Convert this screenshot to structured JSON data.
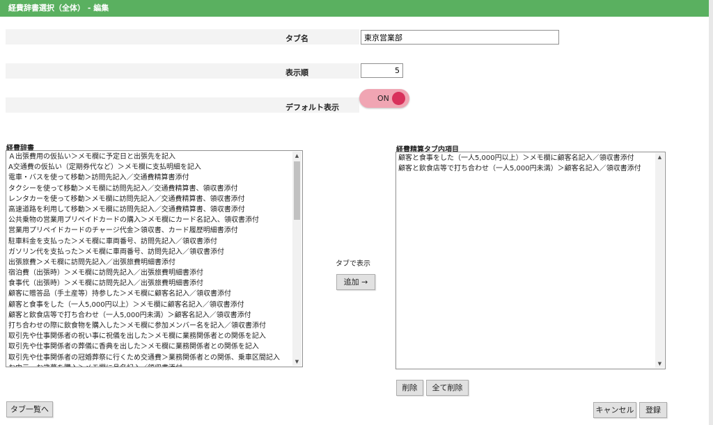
{
  "window": {
    "title": "経費辞書選択（全体） - 編集"
  },
  "form": {
    "tab_name_label": "タブ名",
    "tab_name_value": "東京営業部",
    "display_order_label": "表示順",
    "display_order_value": "5",
    "default_display_label": "デフォルト表示",
    "toggle_label": "ON"
  },
  "expense_dictionary": {
    "label": "経費辞書",
    "items": [
      "Ａ出張費用の仮払い＞メモ欄に予定日と出張先を記入",
      "A交通費の仮払い（定期券代など）＞メモ欄に支払明細を記入",
      "電車・バスを使って移動＞訪問先記入／交通費精算書添付",
      "タクシーを使って移動＞メモ欄に訪問先記入／交通費精算書、領収書添付",
      "レンタカーを使って移動＞メモ欄に訪問先記入／交通費精算書、領収書添付",
      "高速道路を利用して移動＞メモ欄に訪問先記入／交通費精算書、領収書添付",
      "公共乗物の営業用プリペイドカードの購入＞メモ欄にカード名記入、領収書添付",
      "営業用プリペイドカードのチャージ代金＞領収書、カード履歴明細書添付",
      "駐車料金を支払った＞メモ欄に車両番号、訪問先記入／領収書添付",
      "ガソリン代を支払った＞メモ欄に車両番号、訪問先記入／領収書添付",
      "出張旅費＞メモ欄に訪問先記入／出張旅費明細書添付",
      "宿泊費（出張時）＞メモ欄に訪問先記入／出張旅費明細書添付",
      "食事代（出張時）＞メモ欄に訪問先記入／出張旅費明細書添付",
      "顧客に贈答品（手土産等）持参した＞メモ欄に顧客名記入／領収書添付",
      "顧客と食事をした（一人5,000円以上）＞メモ欄に顧客名記入／領収書添付",
      "顧客と飲食店等で打ち合わせ（一人5,000円未満）＞顧客名記入／領収書添付",
      "打ち合わせの際に飲食物を購入した＞メモ欄に参加メンバー名を記入／領収書添付",
      "取引先や仕事関係者の祝い事に祝儀を出した＞メモ欄に業務関係者との関係を記入",
      "取引先や仕事関係者の葬儀に香典を出した＞メモ欄に業務関係者との関係を記入",
      "取引先や仕事関係者の冠婚葬祭に行くため交通費＞業務関係者との関係、乗車区間記入",
      "お中元、お歳暮を購入＞メモ欄に品名記入／領収書添付"
    ]
  },
  "middle": {
    "tab_display_label": "タブで表示",
    "add_button": "追加 →"
  },
  "tab_items": {
    "label": "経費精算タブ内項目",
    "items": [
      "顧客と食事をした（一人5,000円以上）＞メモ欄に顧客名記入／領収書添付",
      "顧客と飲食店等で打ち合わせ（一人5,000円未満）＞顧客名記入／領収書添付"
    ],
    "delete_button": "削除",
    "delete_all_button": "全て削除"
  },
  "footer": {
    "tab_list_button": "タブ一覧へ",
    "cancel_button": "キャンセル",
    "register_button": "登録"
  },
  "colors": {
    "titlebar": "#5ab060",
    "toggle_bg": "#f0a5b3",
    "toggle_knob": "#d8315b"
  }
}
